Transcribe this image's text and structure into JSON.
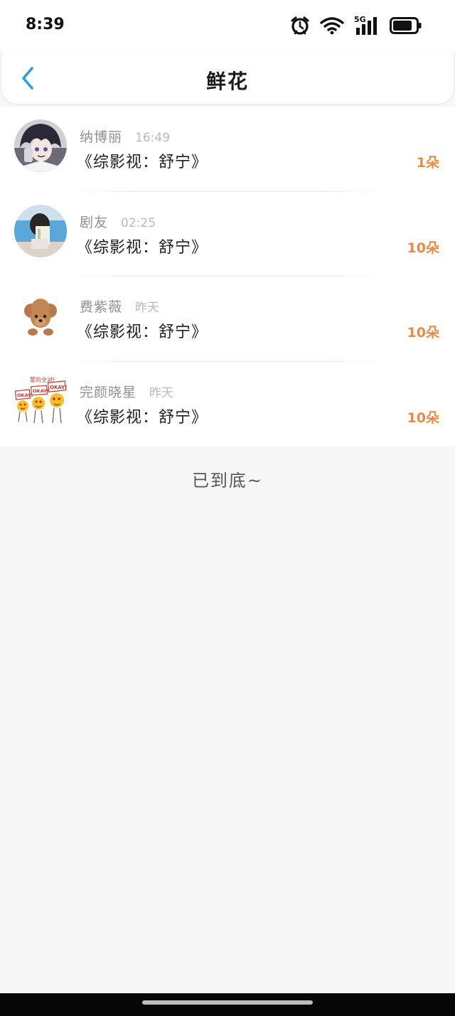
{
  "status": {
    "time": "8:39",
    "network_label": "5G",
    "icons": [
      "alarm-icon",
      "wifi-icon",
      "signal-icon",
      "battery-icon"
    ]
  },
  "header": {
    "title": "鲜花",
    "back_icon": "chevron-left-icon"
  },
  "list": [
    {
      "name": "纳博丽",
      "time": "16:49",
      "book": "《综影视：舒宁》",
      "count": "1朵",
      "avatar": "anime-character-avatar"
    },
    {
      "name": "剧友",
      "time": "02:25",
      "book": "《综影视：舒宁》",
      "count": "10朵",
      "avatar": "person-photo-avatar"
    },
    {
      "name": "费紫薇",
      "time": "昨天",
      "book": "《综影视：舒宁》",
      "count": "10朵",
      "avatar": "poodle-dog-avatar"
    },
    {
      "name": "完颜晓星",
      "time": "昨天",
      "book": "《综影视：舒宁》",
      "count": "10朵",
      "avatar": "okay-sticker-avatar",
      "avatar_text": "蒙的全对!",
      "avatar_sign": "OKAY!"
    }
  ],
  "footer": {
    "end_text": "已到底~"
  },
  "colors": {
    "accent_blue": "#2f9be0",
    "count_orange": "#e98a43",
    "background": "#f8f7f7"
  }
}
